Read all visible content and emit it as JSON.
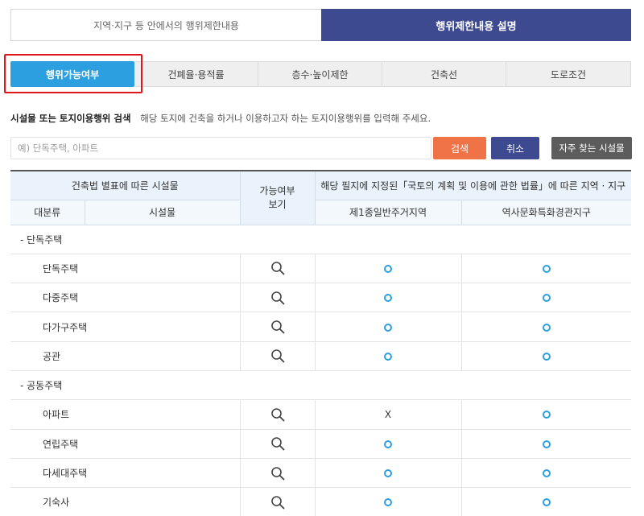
{
  "top_tabs": [
    {
      "label": "지역·지구 등 안에서의 행위제한내용",
      "active": false
    },
    {
      "label": "행위제한내용 설명",
      "active": true
    }
  ],
  "sub_tabs": [
    "행위가능여부",
    "건폐율·용적률",
    "층수·높이제한",
    "건축선",
    "도로조건"
  ],
  "search": {
    "label": "시설물 또는 토지이용행위 검색",
    "description": "해당 토지에 건축을 하거나 이용하고자 하는 토지이용행위를 입력해 주세요.",
    "placeholder": "예) 단독주택, 아파트",
    "value": "",
    "search_button": "검색",
    "cancel_button": "취소",
    "frequent_button": "자주 찾는 시설물"
  },
  "table": {
    "header_facility_group": "건축법 별표에 따른 시설물",
    "header_possible": "가능여부\n보기",
    "header_zone_group": "해당 필지에 지정된「국토의 계획 및 이용에 관한 법률」에 따른 지역 · 지구",
    "col_category": "대분류",
    "col_facility": "시설물",
    "zones": [
      "제1종일반주거지역",
      "역사문화특화경관지구"
    ],
    "groups": [
      {
        "name": "- 단독주택",
        "rows": [
          {
            "facility": "단독주택",
            "zone_values": [
              "O",
              "O"
            ]
          },
          {
            "facility": "다중주택",
            "zone_values": [
              "O",
              "O"
            ]
          },
          {
            "facility": "다가구주택",
            "zone_values": [
              "O",
              "O"
            ]
          },
          {
            "facility": "공관",
            "zone_values": [
              "O",
              "O"
            ]
          }
        ]
      },
      {
        "name": "- 공동주택",
        "rows": [
          {
            "facility": "아파트",
            "zone_values": [
              "X",
              "O"
            ]
          },
          {
            "facility": "연립주택",
            "zone_values": [
              "O",
              "O"
            ]
          },
          {
            "facility": "다세대주택",
            "zone_values": [
              "O",
              "O"
            ]
          },
          {
            "facility": "기숙사",
            "zone_values": [
              "O",
              "O"
            ]
          }
        ]
      }
    ]
  },
  "colors": {
    "primary_navy": "#3d4a8f",
    "accent_blue": "#2b9fe0",
    "search_orange": "#ef7346",
    "frequent_gray": "#5c5c5c",
    "highlight_red": "#e0161b"
  },
  "icons": {
    "possible_view": "magnifier-icon",
    "allowed": "circle-icon"
  }
}
